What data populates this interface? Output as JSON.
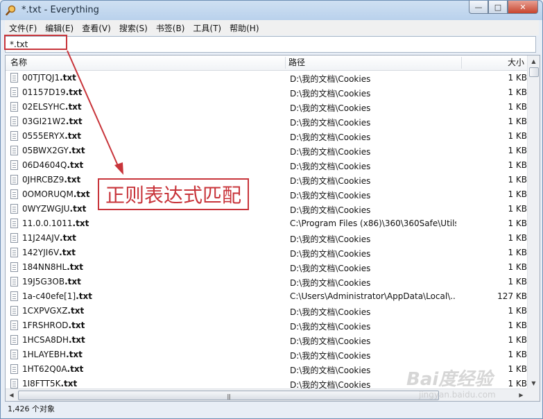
{
  "window": {
    "title": "*.txt - Everything",
    "minimize": "—",
    "maximize": "□",
    "close": "✕"
  },
  "menu": [
    "文件(F)",
    "编辑(E)",
    "查看(V)",
    "搜索(S)",
    "书签(B)",
    "工具(T)",
    "帮助(H)"
  ],
  "search": {
    "value": "*.txt"
  },
  "columns": {
    "name": "名称",
    "path": "路径",
    "size": "大小"
  },
  "rows": [
    {
      "stem": "00TJTQJ1",
      "ext": ".txt",
      "path": "D:\\我的文档\\Cookies",
      "size": "1 KB"
    },
    {
      "stem": "01157D19",
      "ext": ".txt",
      "path": "D:\\我的文档\\Cookies",
      "size": "1 KB"
    },
    {
      "stem": "02ELSYHC",
      "ext": ".txt",
      "path": "D:\\我的文档\\Cookies",
      "size": "1 KB"
    },
    {
      "stem": "03GI21W2",
      "ext": ".txt",
      "path": "D:\\我的文档\\Cookies",
      "size": "1 KB"
    },
    {
      "stem": "0555ERYX",
      "ext": ".txt",
      "path": "D:\\我的文档\\Cookies",
      "size": "1 KB"
    },
    {
      "stem": "05BWX2GY",
      "ext": ".txt",
      "path": "D:\\我的文档\\Cookies",
      "size": "1 KB"
    },
    {
      "stem": "06D4604Q",
      "ext": ".txt",
      "path": "D:\\我的文档\\Cookies",
      "size": "1 KB"
    },
    {
      "stem": "0JHRCBZ9",
      "ext": ".txt",
      "path": "D:\\我的文档\\Cookies",
      "size": "1 KB"
    },
    {
      "stem": "0OMORUQM",
      "ext": ".txt",
      "path": "D:\\我的文档\\Cookies",
      "size": "1 KB"
    },
    {
      "stem": "0WYZWGJU",
      "ext": ".txt",
      "path": "D:\\我的文档\\Cookies",
      "size": "1 KB"
    },
    {
      "stem": "11.0.0.1011",
      "ext": ".txt",
      "path": "C:\\Program Files (x86)\\360\\360Safe\\Utils",
      "size": "1 KB"
    },
    {
      "stem": "11J24AJV",
      "ext": ".txt",
      "path": "D:\\我的文档\\Cookies",
      "size": "1 KB"
    },
    {
      "stem": "142YJI6V",
      "ext": ".txt",
      "path": "D:\\我的文档\\Cookies",
      "size": "1 KB"
    },
    {
      "stem": "184NN8HL",
      "ext": ".txt",
      "path": "D:\\我的文档\\Cookies",
      "size": "1 KB"
    },
    {
      "stem": "19J5G3OB",
      "ext": ".txt",
      "path": "D:\\我的文档\\Cookies",
      "size": "1 KB"
    },
    {
      "stem": "1a-c40efe[1]",
      "ext": ".txt",
      "path": "C:\\Users\\Administrator\\AppData\\Local\\...",
      "size": "127 KB"
    },
    {
      "stem": "1CXPVGXZ",
      "ext": ".txt",
      "path": "D:\\我的文档\\Cookies",
      "size": "1 KB"
    },
    {
      "stem": "1FRSHROD",
      "ext": ".txt",
      "path": "D:\\我的文档\\Cookies",
      "size": "1 KB"
    },
    {
      "stem": "1HCSA8DH",
      "ext": ".txt",
      "path": "D:\\我的文档\\Cookies",
      "size": "1 KB"
    },
    {
      "stem": "1HLAYEBH",
      "ext": ".txt",
      "path": "D:\\我的文档\\Cookies",
      "size": "1 KB"
    },
    {
      "stem": "1HT62Q0A",
      "ext": ".txt",
      "path": "D:\\我的文档\\Cookies",
      "size": "1 KB"
    },
    {
      "stem": "1I8FTT5K",
      "ext": ".txt",
      "path": "D:\\我的文档\\Cookies",
      "size": "1 KB"
    }
  ],
  "status": {
    "text": "1,426 个对象"
  },
  "annotation": {
    "text": "正则表达式匹配",
    "color": "#c8343a"
  },
  "watermark": {
    "main": "Bai度经验",
    "sub": "jingyan.baidu.com"
  },
  "icons": {
    "app": "magnifier-icon",
    "file": "text-file-icon"
  }
}
